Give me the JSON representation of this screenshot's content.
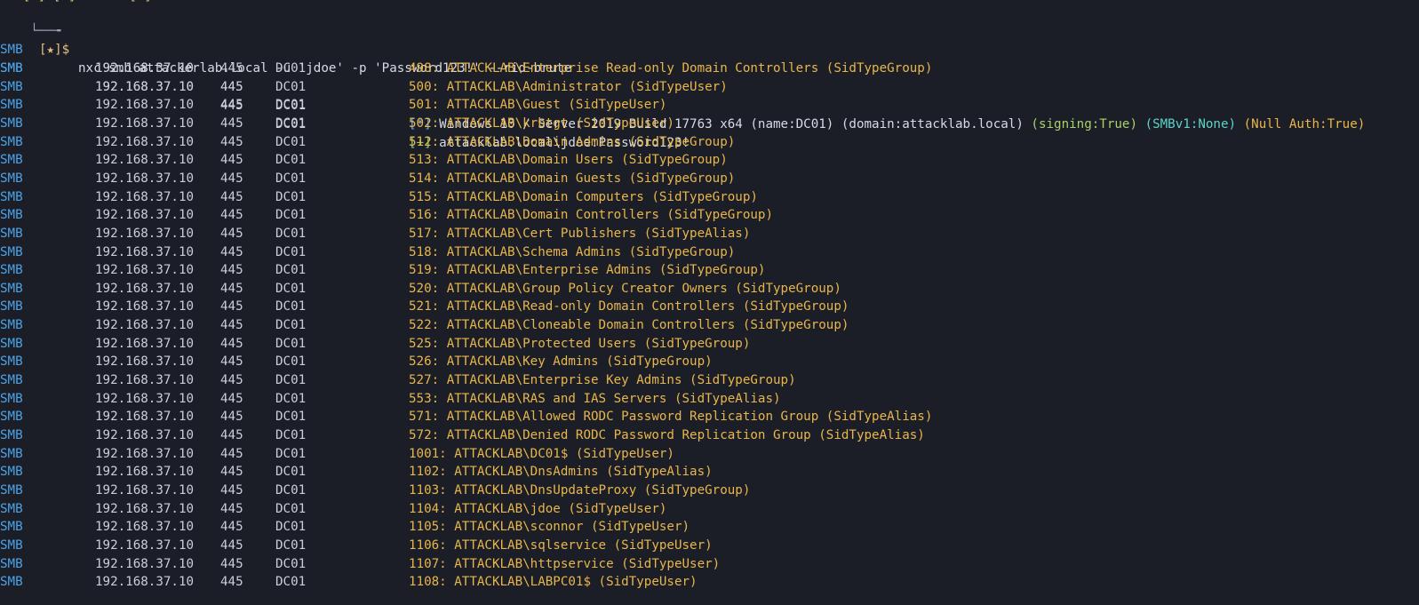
{
  "terminal": {
    "top_fragment": "   [*] [*]       [*]",
    "prompt": {
      "corner": "└──╼",
      "marker": "[★]$",
      "command": "nxc smb attackerlab.local -u 'jdoe' -p 'Password123!' --rid-brute"
    },
    "info_line": {
      "proto": "SMB",
      "ip": "192.168.37.10",
      "port": "445",
      "name": "DC01",
      "marker": "[*]",
      "text": "Windows 10 / Server 2019 Build 17763 x64 (name:DC01) (domain:attacklab.local)",
      "signing": "(signing:True)",
      "smbv1": "(SMBv1:None)",
      "null_auth": "(Null Auth:True)"
    },
    "auth_line": {
      "proto": "SMB",
      "ip": "192.168.37.10",
      "port": "445",
      "name": "DC01",
      "marker": "[+]",
      "text": "attacklab.local\\jdoe:Password123!"
    },
    "rid_rows": [
      {
        "proto": "SMB",
        "ip": "192.168.37.10",
        "port": "445",
        "name": "DC01",
        "text": "498: ATTACKLAB\\Enterprise Read-only Domain Controllers (SidTypeGroup)"
      },
      {
        "proto": "SMB",
        "ip": "192.168.37.10",
        "port": "445",
        "name": "DC01",
        "text": "500: ATTACKLAB\\Administrator (SidTypeUser)"
      },
      {
        "proto": "SMB",
        "ip": "192.168.37.10",
        "port": "445",
        "name": "DC01",
        "text": "501: ATTACKLAB\\Guest (SidTypeUser)"
      },
      {
        "proto": "SMB",
        "ip": "192.168.37.10",
        "port": "445",
        "name": "DC01",
        "text": "502: ATTACKLAB\\krbtgt (SidTypeUser)"
      },
      {
        "proto": "SMB",
        "ip": "192.168.37.10",
        "port": "445",
        "name": "DC01",
        "text": "512: ATTACKLAB\\Domain Admins (SidTypeGroup)"
      },
      {
        "proto": "SMB",
        "ip": "192.168.37.10",
        "port": "445",
        "name": "DC01",
        "text": "513: ATTACKLAB\\Domain Users (SidTypeGroup)"
      },
      {
        "proto": "SMB",
        "ip": "192.168.37.10",
        "port": "445",
        "name": "DC01",
        "text": "514: ATTACKLAB\\Domain Guests (SidTypeGroup)"
      },
      {
        "proto": "SMB",
        "ip": "192.168.37.10",
        "port": "445",
        "name": "DC01",
        "text": "515: ATTACKLAB\\Domain Computers (SidTypeGroup)"
      },
      {
        "proto": "SMB",
        "ip": "192.168.37.10",
        "port": "445",
        "name": "DC01",
        "text": "516: ATTACKLAB\\Domain Controllers (SidTypeGroup)"
      },
      {
        "proto": "SMB",
        "ip": "192.168.37.10",
        "port": "445",
        "name": "DC01",
        "text": "517: ATTACKLAB\\Cert Publishers (SidTypeAlias)"
      },
      {
        "proto": "SMB",
        "ip": "192.168.37.10",
        "port": "445",
        "name": "DC01",
        "text": "518: ATTACKLAB\\Schema Admins (SidTypeGroup)"
      },
      {
        "proto": "SMB",
        "ip": "192.168.37.10",
        "port": "445",
        "name": "DC01",
        "text": "519: ATTACKLAB\\Enterprise Admins (SidTypeGroup)"
      },
      {
        "proto": "SMB",
        "ip": "192.168.37.10",
        "port": "445",
        "name": "DC01",
        "text": "520: ATTACKLAB\\Group Policy Creator Owners (SidTypeGroup)"
      },
      {
        "proto": "SMB",
        "ip": "192.168.37.10",
        "port": "445",
        "name": "DC01",
        "text": "521: ATTACKLAB\\Read-only Domain Controllers (SidTypeGroup)"
      },
      {
        "proto": "SMB",
        "ip": "192.168.37.10",
        "port": "445",
        "name": "DC01",
        "text": "522: ATTACKLAB\\Cloneable Domain Controllers (SidTypeGroup)"
      },
      {
        "proto": "SMB",
        "ip": "192.168.37.10",
        "port": "445",
        "name": "DC01",
        "text": "525: ATTACKLAB\\Protected Users (SidTypeGroup)"
      },
      {
        "proto": "SMB",
        "ip": "192.168.37.10",
        "port": "445",
        "name": "DC01",
        "text": "526: ATTACKLAB\\Key Admins (SidTypeGroup)"
      },
      {
        "proto": "SMB",
        "ip": "192.168.37.10",
        "port": "445",
        "name": "DC01",
        "text": "527: ATTACKLAB\\Enterprise Key Admins (SidTypeGroup)"
      },
      {
        "proto": "SMB",
        "ip": "192.168.37.10",
        "port": "445",
        "name": "DC01",
        "text": "553: ATTACKLAB\\RAS and IAS Servers (SidTypeAlias)"
      },
      {
        "proto": "SMB",
        "ip": "192.168.37.10",
        "port": "445",
        "name": "DC01",
        "text": "571: ATTACKLAB\\Allowed RODC Password Replication Group (SidTypeAlias)"
      },
      {
        "proto": "SMB",
        "ip": "192.168.37.10",
        "port": "445",
        "name": "DC01",
        "text": "572: ATTACKLAB\\Denied RODC Password Replication Group (SidTypeAlias)"
      },
      {
        "proto": "SMB",
        "ip": "192.168.37.10",
        "port": "445",
        "name": "DC01",
        "text": "1001: ATTACKLAB\\DC01$ (SidTypeUser)"
      },
      {
        "proto": "SMB",
        "ip": "192.168.37.10",
        "port": "445",
        "name": "DC01",
        "text": "1102: ATTACKLAB\\DnsAdmins (SidTypeAlias)"
      },
      {
        "proto": "SMB",
        "ip": "192.168.37.10",
        "port": "445",
        "name": "DC01",
        "text": "1103: ATTACKLAB\\DnsUpdateProxy (SidTypeGroup)"
      },
      {
        "proto": "SMB",
        "ip": "192.168.37.10",
        "port": "445",
        "name": "DC01",
        "text": "1104: ATTACKLAB\\jdoe (SidTypeUser)"
      },
      {
        "proto": "SMB",
        "ip": "192.168.37.10",
        "port": "445",
        "name": "DC01",
        "text": "1105: ATTACKLAB\\sconnor (SidTypeUser)"
      },
      {
        "proto": "SMB",
        "ip": "192.168.37.10",
        "port": "445",
        "name": "DC01",
        "text": "1106: ATTACKLAB\\sqlservice (SidTypeUser)"
      },
      {
        "proto": "SMB",
        "ip": "192.168.37.10",
        "port": "445",
        "name": "DC01",
        "text": "1107: ATTACKLAB\\httpservice (SidTypeUser)"
      },
      {
        "proto": "SMB",
        "ip": "192.168.37.10",
        "port": "445",
        "name": "DC01",
        "text": "1108: ATTACKLAB\\LABPC01$ (SidTypeUser)"
      }
    ],
    "colors": {
      "background": "#1b1e27",
      "proto": "#4aa3e8",
      "result_text": "#e8b64c",
      "info_marker": "#5fa8f0",
      "success_marker": "#8ad06a"
    }
  }
}
